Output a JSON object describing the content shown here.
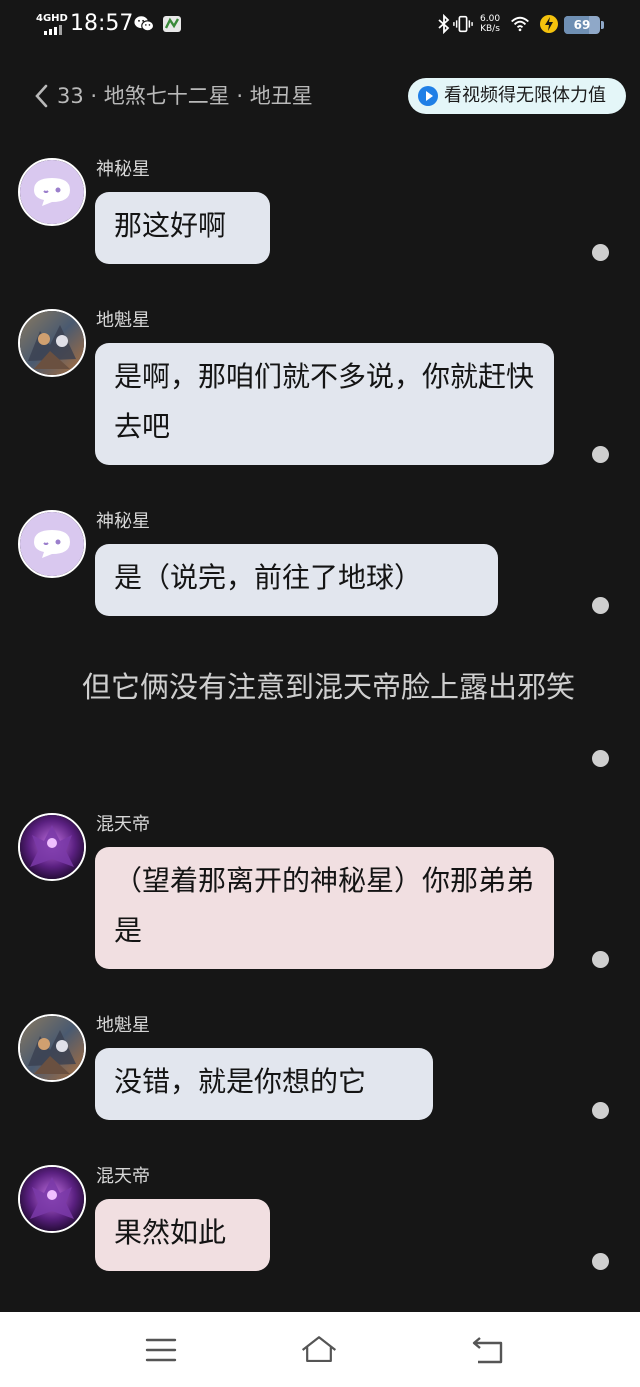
{
  "status_bar": {
    "network": "4GHD",
    "time": "18:57",
    "speed_value": "6.00",
    "speed_unit": "KB/s",
    "battery": "69",
    "battery_level": 0.69,
    "icons": [
      "wechat-icon",
      "game-app-icon",
      "bluetooth-icon",
      "vibrate-icon",
      "wifi-icon",
      "charging-icon"
    ]
  },
  "header": {
    "title": "33 · 地煞七十二星 · 地丑星",
    "video_button": "看视频得无限体力值"
  },
  "messages": [
    {
      "sender": "神秘星",
      "text": "那这好啊",
      "style": "blue",
      "avatar": "ghost-avatar"
    },
    {
      "sender": "地魁星",
      "text": "是啊，那咱们就不多说，你就赶快去吧",
      "style": "blue",
      "avatar": "robot-avatar"
    },
    {
      "sender": "神秘星",
      "text": "是（说完，前往了地球）",
      "style": "blue",
      "avatar": "ghost-avatar"
    },
    {
      "sender": "混天帝",
      "text": "（望着那离开的神秘星）你那弟弟是",
      "style": "pink",
      "avatar": "purple-robot-avatar"
    },
    {
      "sender": "地魁星",
      "text": "没错，就是你想的它",
      "style": "blue",
      "avatar": "robot-avatar"
    },
    {
      "sender": "混天帝",
      "text": "果然如此",
      "style": "pink",
      "avatar": "purple-robot-avatar"
    }
  ],
  "narration": "但它俩没有注意到混天帝脸上露出邪笑",
  "colors": {
    "background": "#161616",
    "bubble_blue": "#e2e6ee",
    "bubble_pink": "#f1dfe1",
    "accent": "#1f7fe6"
  },
  "navbar": {
    "icons": [
      "menu-icon",
      "home-icon",
      "back-nav-icon"
    ]
  }
}
